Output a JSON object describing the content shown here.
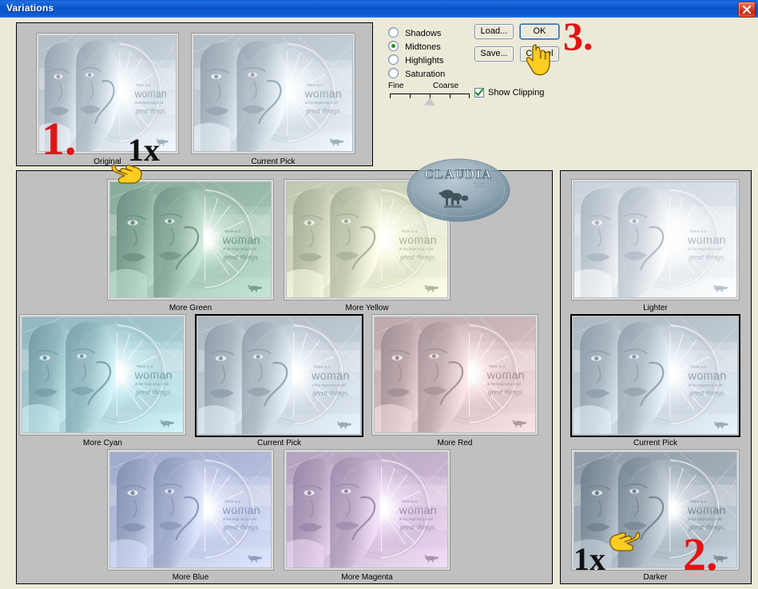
{
  "window": {
    "title": "Variations",
    "close_label": "Close",
    "titlebar_color": "#0a4fc4",
    "dialog_bg": "#ece9d8",
    "panel_bg": "#c0c0c0"
  },
  "top_preview": {
    "items": [
      {
        "label": "Original",
        "key": "original"
      },
      {
        "label": "Current Pick",
        "key": "current_pick"
      }
    ]
  },
  "controls": {
    "radios": [
      {
        "label": "Shadows",
        "selected": false
      },
      {
        "label": "Midtones",
        "selected": true
      },
      {
        "label": "Highlights",
        "selected": false
      },
      {
        "label": "Saturation",
        "selected": false
      }
    ],
    "slider": {
      "min_label": "Fine",
      "max_label": "Coarse",
      "ticks": 5,
      "position": 3
    },
    "buttons": [
      {
        "label": "Load...",
        "focused": false
      },
      {
        "label": "OK",
        "focused": true
      },
      {
        "label": "Save...",
        "focused": false
      },
      {
        "label": "Cancel",
        "focused": false
      }
    ],
    "checkbox": {
      "label": "Show Clipping",
      "checked": true
    }
  },
  "color_grid": {
    "rows": [
      [
        {
          "label": "More Green",
          "tint": "#9fbfae",
          "selected": false
        },
        {
          "label": "More Yellow",
          "tint": "#d7dcc0",
          "selected": false
        }
      ],
      [
        {
          "label": "More Cyan",
          "tint": "#a8ccd2",
          "selected": false
        },
        {
          "label": "Current Pick",
          "tint": "#c2ccd4",
          "selected": true
        },
        {
          "label": "More Red",
          "tint": "#d4bcbe",
          "selected": false
        }
      ],
      [
        {
          "label": "More Blue",
          "tint": "#b7bfdd",
          "selected": false
        },
        {
          "label": "More Magenta",
          "tint": "#cbb6d2",
          "selected": false
        }
      ]
    ]
  },
  "brightness_column": {
    "items": [
      {
        "label": "Lighter",
        "tint": "#dfe6ec",
        "selected": false
      },
      {
        "label": "Current Pick",
        "tint": "#c2ccd4",
        "selected": true
      },
      {
        "label": "Darker",
        "tint": "#a5b0ba",
        "selected": false
      }
    ]
  },
  "annotations": {
    "step1": "1.",
    "step2": "2.",
    "step3": "3.",
    "mult_left": "1x",
    "mult_right": "1x"
  },
  "artwork": {
    "line1": "There is a",
    "line2": "woman",
    "line3": "at the beginning of all",
    "line4": "great things."
  },
  "watermark": {
    "name": "CLAUDIA",
    "year": "2012"
  }
}
